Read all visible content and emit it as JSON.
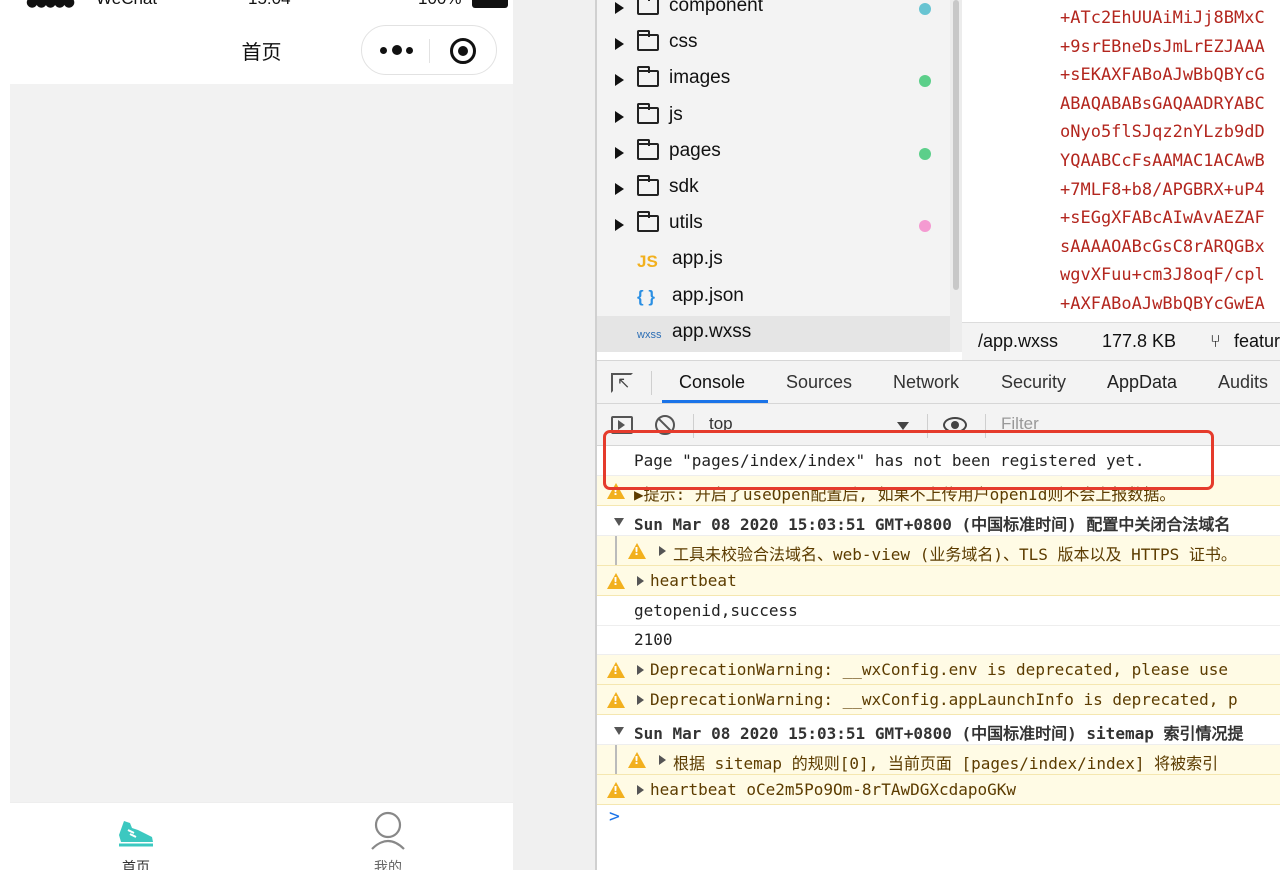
{
  "simulator": {
    "status": {
      "carrier": "WeChat",
      "time": "15:04",
      "battery": "100%"
    },
    "nav_title": "首页",
    "tabbar": [
      {
        "label": "首页",
        "icon": "shoe-icon",
        "active": true,
        "color": "#3cc8c0"
      },
      {
        "label": "我的",
        "icon": "user-icon",
        "active": false,
        "color": "#666666"
      }
    ]
  },
  "file_tree": {
    "items": [
      {
        "type": "folder",
        "name": "component",
        "dot": "#68c4d2"
      },
      {
        "type": "folder",
        "name": "css",
        "dot": ""
      },
      {
        "type": "folder",
        "name": "images",
        "dot": "#5ccf8a"
      },
      {
        "type": "folder",
        "name": "js",
        "dot": ""
      },
      {
        "type": "folder",
        "name": "pages",
        "dot": "#5ccf8a"
      },
      {
        "type": "folder",
        "name": "sdk",
        "dot": ""
      },
      {
        "type": "folder",
        "name": "utils",
        "dot": "#f49ad1"
      },
      {
        "type": "file",
        "name": "app.js",
        "icon": "JS"
      },
      {
        "type": "file",
        "name": "app.json",
        "icon": "{ }"
      },
      {
        "type": "file",
        "name": "app.wxss",
        "icon": "wxss",
        "selected": true
      }
    ]
  },
  "code": {
    "lines": [
      "+ATc2EhUUAiMiJj8BMxC",
      "+9srEBneDsJmLrEZJAAA",
      "+sEKAXFABoAJwBbQBYcG",
      "ABAQABABsGAQAADRYABC",
      "oNyo5flSJqz2nYLzb9dD",
      "YQAABCcFsAAMAC1ACAwB",
      "+7MLF8+b8/APGBRX+uP4",
      "+sEGgXFABcAIwAvAEZAF",
      "sAAAAOABcGsC8rARQGBx",
      "wgvXFuu+cm3J8oqF/cpl",
      "+AXFABoAJwBbQBYcGwEA"
    ]
  },
  "file_status": {
    "path": "/app.wxss",
    "size": "177.8 KB",
    "branch": "featur"
  },
  "devtools": {
    "tabs": [
      "Console",
      "Sources",
      "Network",
      "Security",
      "AppData",
      "Audits"
    ],
    "active_tab": "Console",
    "context": "top",
    "filter_placeholder": "Filter",
    "messages": [
      {
        "kind": "log",
        "text": "Page \"pages/index/index\" has not been registered yet."
      },
      {
        "kind": "warn",
        "text": "▶提示: 开启了useOpen配置后, 如果不上传用户openId则不会上报数据。"
      },
      {
        "kind": "group",
        "text": "Sun Mar 08 2020 15:03:51 GMT+0800 (中国标准时间) 配置中关闭合法域名"
      },
      {
        "kind": "warn-nested",
        "text": "工具未校验合法域名、web-view (业务域名)、TLS 版本以及 HTTPS 证书。"
      },
      {
        "kind": "warn",
        "text": "heartbeat"
      },
      {
        "kind": "log",
        "text": "getopenid,success"
      },
      {
        "kind": "log",
        "text": "2100"
      },
      {
        "kind": "warn",
        "text": "DeprecationWarning: __wxConfig.env is deprecated, please use"
      },
      {
        "kind": "warn",
        "text": "DeprecationWarning: __wxConfig.appLaunchInfo is deprecated, p"
      },
      {
        "kind": "group",
        "text": "Sun Mar 08 2020 15:03:51 GMT+0800 (中国标准时间) sitemap 索引情况提"
      },
      {
        "kind": "warn-nested",
        "text": "根据 sitemap 的规则[0], 当前页面 [pages/index/index] 将被索引"
      },
      {
        "kind": "warn",
        "text": "heartbeat oCe2m5Po9Om-8rTAwDGXcdapoGKw"
      }
    ],
    "prompt": ">"
  },
  "annotation": {
    "color": "#e53b2c"
  }
}
